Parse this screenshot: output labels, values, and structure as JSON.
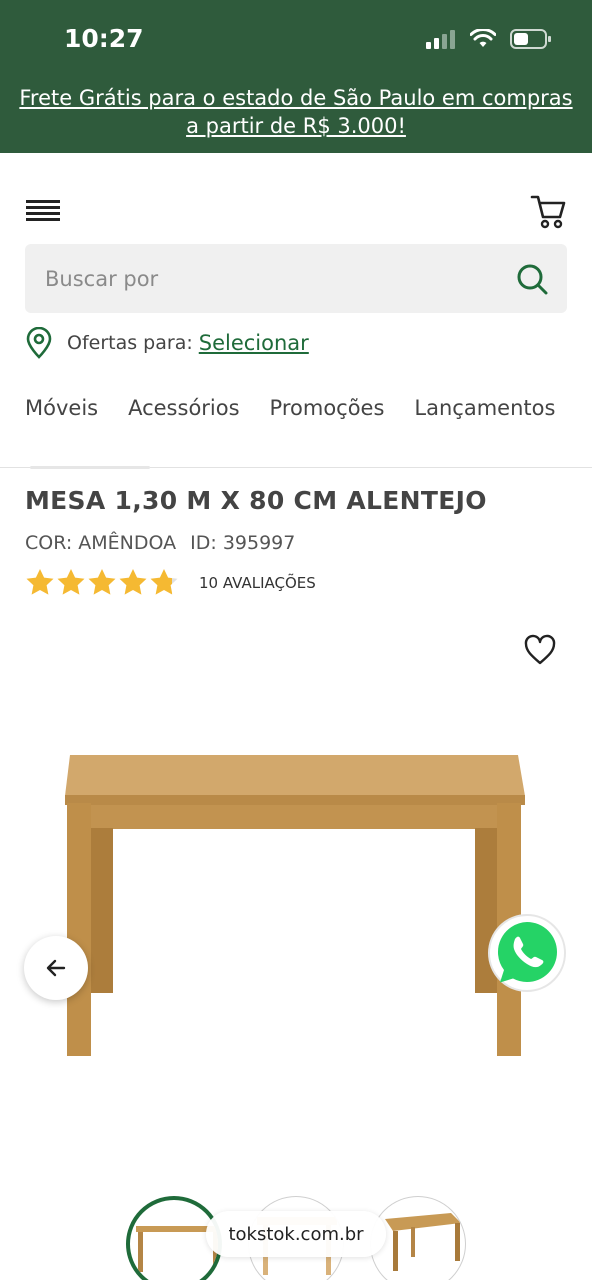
{
  "status_bar": {
    "time": "10:27"
  },
  "promo": {
    "line1": "Frete Grátis para o estado de São Paulo em compras",
    "line2": "a partir de R$ 3.000!"
  },
  "header": {
    "menu_icon": "hamburger-menu-icon",
    "cart_icon": "cart-icon"
  },
  "search": {
    "placeholder": "Buscar por"
  },
  "offers": {
    "label": "Ofertas para:",
    "link": "Selecionar"
  },
  "nav": {
    "items": [
      "Móveis",
      "Acessórios",
      "Promoções",
      "Lançamentos"
    ]
  },
  "product": {
    "title": "MESA 1,30 M X 80 CM ALENTEJO",
    "color": "COR: AMÊNDOA",
    "id": "ID: 395997",
    "rating": 4.8,
    "reviews": "10 AVALIAÇÕES"
  },
  "browser": {
    "url": "tokstok.com.br"
  },
  "colors": {
    "brand_green": "#2f5b3c",
    "link_green": "#1f6b3a",
    "star": "#f5b932",
    "wood": "#c89a55"
  }
}
